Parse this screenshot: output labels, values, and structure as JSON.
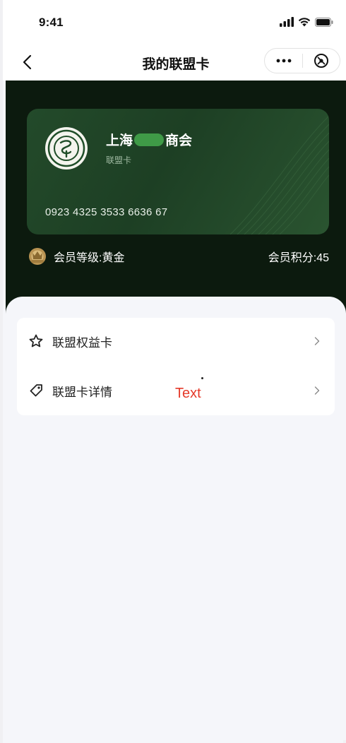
{
  "status_bar": {
    "time": "9:41"
  },
  "nav": {
    "title": "我的联盟卡"
  },
  "card": {
    "name_prefix": "上海",
    "name_suffix": "商会",
    "subtitle": "联盟卡",
    "number": "0923 4325 3533 6636 67"
  },
  "member": {
    "level_label": "会员等级:黄金",
    "points_label": "会员积分:45"
  },
  "menu": {
    "items": [
      {
        "label": "联盟权益卡",
        "icon": "star-icon"
      },
      {
        "label": "联盟卡详情",
        "icon": "tag-icon"
      }
    ]
  },
  "overlay": {
    "text": "Text"
  },
  "colors": {
    "hero_bg": "#0c1a0e",
    "card_green": "#234a2a",
    "overlay_red": "#e53a2a"
  }
}
